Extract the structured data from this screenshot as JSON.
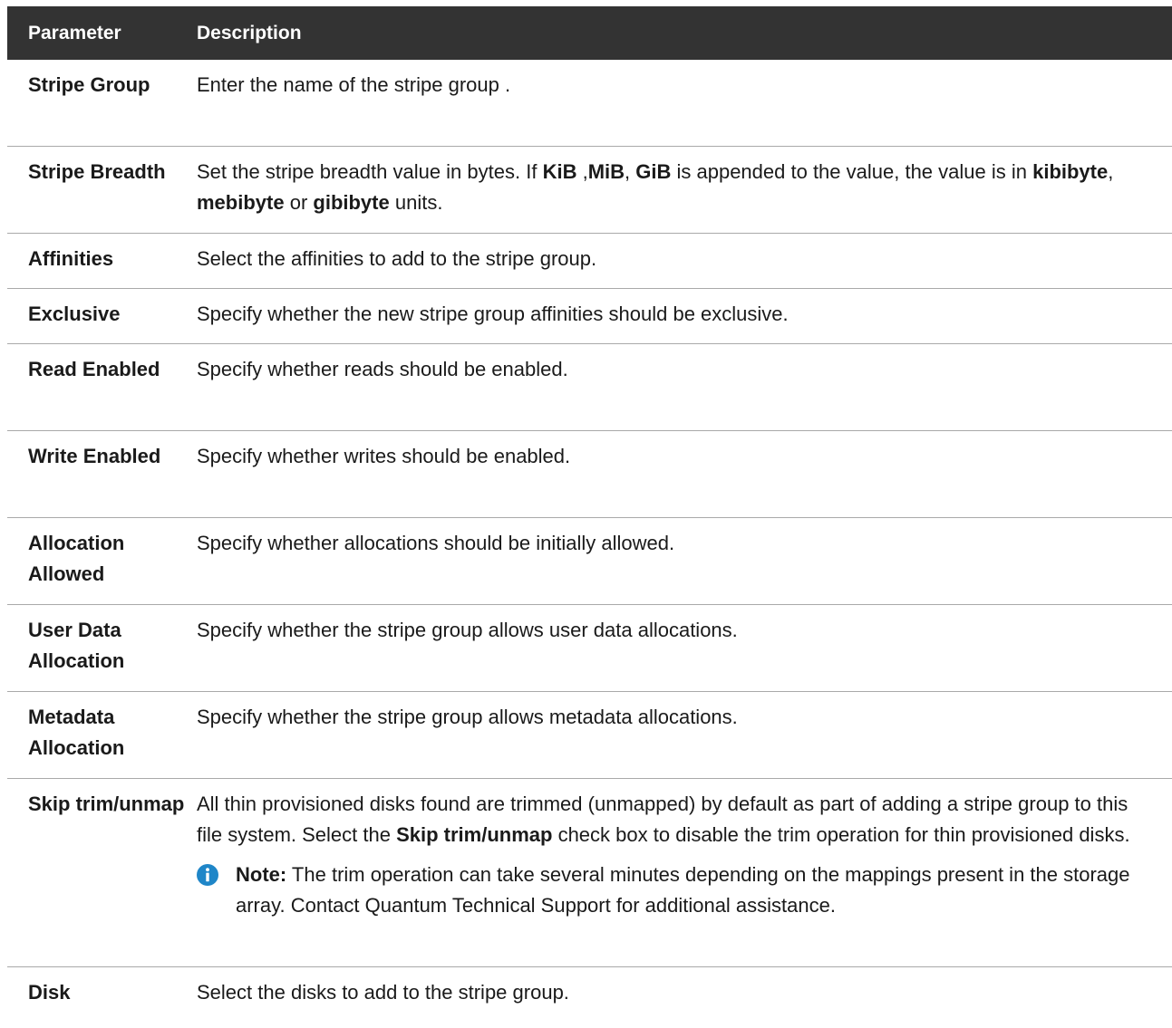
{
  "table": {
    "header": {
      "parameter": "Parameter",
      "description": "Description"
    },
    "rows": [
      {
        "param": "Stripe Group",
        "description": "Enter the name of the stripe group ."
      },
      {
        "param": "Stripe Breadth",
        "description_parts": [
          "Set the stripe breadth value in bytes. If ",
          "KiB",
          " ,",
          "MiB",
          ", ",
          "GiB",
          " is appended to the value, the value is in ",
          "kibibyte",
          ", ",
          "mebibyte",
          " or ",
          "gibibyte",
          " units."
        ]
      },
      {
        "param": "Affinities",
        "description": "Select the affinities to add to the stripe group."
      },
      {
        "param": "Exclusive",
        "description": "Specify whether the new stripe group affinities should be exclusive."
      },
      {
        "param": "Read Enabled",
        "description": "Specify whether reads should be enabled."
      },
      {
        "param": "Write Enabled",
        "description": "Specify whether writes should be enabled."
      },
      {
        "param": "Allocation Allowed",
        "description": "Specify whether allocations should be initially allowed."
      },
      {
        "param": "User Data Allocation",
        "description": "Specify whether the stripe group allows user data allocations."
      },
      {
        "param": "Metadata Allocation",
        "description": "Specify whether the stripe group allows metadata allocations."
      },
      {
        "param": "Skip trim/unmap",
        "description_parts": [
          "All thin provisioned disks found are trimmed (unmapped) by default as part of adding a stripe group to this file system. Select the ",
          "Skip trim/unmap",
          " check box to disable the trim operation for thin provisioned disks."
        ],
        "note": {
          "label": "Note:",
          "text": " The trim operation can take several minutes depending on the mappings present in the storage array. Contact Quantum Technical Support for additional assistance.",
          "icon": "info-icon"
        }
      },
      {
        "param": "Disk",
        "description": "Select the disks to add to the stripe group."
      }
    ]
  },
  "colors": {
    "header_bg": "#333333",
    "header_text": "#ffffff",
    "divider": "#a9a9a9",
    "note_icon": "#1f86c8"
  }
}
